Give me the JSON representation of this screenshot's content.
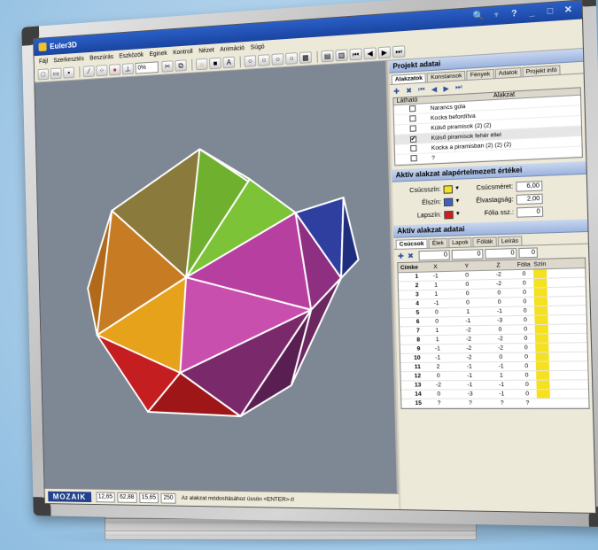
{
  "window": {
    "title": "Euler3D",
    "controls": [
      "🔍",
      "♆",
      "?",
      "_",
      "□",
      "✕"
    ]
  },
  "menu": [
    "Fájl",
    "Szerkesztés",
    "Beszúrás",
    "Eszközök",
    "Eginek",
    "Kontroll",
    "Nézet",
    "Animáció",
    "Súgó"
  ],
  "toolbar": {
    "zoom_value": "0%"
  },
  "status": {
    "logo": "MOZAIK",
    "coords": [
      "12,65",
      "62,88",
      "15,65",
      "250"
    ],
    "hint": "Az alakzat módosításához üssön <ENTER>-t!"
  },
  "panel": {
    "project_title": "Projekt adatai",
    "project_tabs": [
      "Alakzatok",
      "Konstansok",
      "Fények",
      "Adatok",
      "Projekt infó"
    ],
    "shapes_header": {
      "visible": "Látható",
      "shape": "Alakzat"
    },
    "shapes": [
      {
        "label": "Narancs gúla",
        "checked": ""
      },
      {
        "label": "Kocka befordítva",
        "checked": ""
      },
      {
        "label": "Külső piramisok (2) (2)",
        "checked": ""
      },
      {
        "label": "Külső piramisok fehér éllel",
        "checked": "✔"
      },
      {
        "label": "Kocka a piramisban (2) (2) (2)",
        "checked": ""
      },
      {
        "label": "?",
        "checked": ""
      }
    ],
    "defaults_title": "Aktív alakzat alapértelmezett értékei",
    "defaults": {
      "vertex_color_label": "Csúcsszín:",
      "edge_color_label": "Élszín:",
      "face_color_label": "Lapszín:",
      "vertex_size_label": "Csúcsméret:",
      "vertex_size": "6,00",
      "edge_thickness_label": "Élvastagság:",
      "edge_thickness": "2,00",
      "foil_label": "Fólia ssz.:",
      "foil": "0",
      "colors": {
        "vertex": "#f5e11f",
        "edge": "#3e5fc7",
        "face": "#d41c1c"
      }
    },
    "active_title": "Aktív alakzat adatai",
    "active_tabs": [
      "Csúcsok",
      "Élek",
      "Lapok",
      "Fóliák",
      "Leírás"
    ],
    "filter_values": [
      "0",
      "0",
      "0",
      "0"
    ],
    "table_headers": [
      "Címke",
      "X",
      "Y",
      "Z",
      "Fólia",
      "Szín"
    ],
    "rows": [
      [
        "1",
        "-1",
        "0",
        "-2",
        "0"
      ],
      [
        "2",
        "1",
        "0",
        "-2",
        "0"
      ],
      [
        "3",
        "1",
        "0",
        "0",
        "0"
      ],
      [
        "4",
        "-1",
        "0",
        "0",
        "0"
      ],
      [
        "5",
        "0",
        "1",
        "-1",
        "0"
      ],
      [
        "6",
        "0",
        "-1",
        "-3",
        "0"
      ],
      [
        "7",
        "1",
        "-2",
        "0",
        "0"
      ],
      [
        "8",
        "1",
        "-2",
        "-2",
        "0"
      ],
      [
        "9",
        "-1",
        "-2",
        "-2",
        "0"
      ],
      [
        "10",
        "-1",
        "-2",
        "0",
        "0"
      ],
      [
        "11",
        "2",
        "-1",
        "-1",
        "0"
      ],
      [
        "12",
        "0",
        "-1",
        "1",
        "0"
      ],
      [
        "13",
        "-2",
        "-1",
        "-1",
        "0"
      ],
      [
        "14",
        "0",
        "-3",
        "-1",
        "0"
      ],
      [
        "15",
        "?",
        "?",
        "?",
        "?"
      ]
    ],
    "row_color": "#f5e11f"
  }
}
